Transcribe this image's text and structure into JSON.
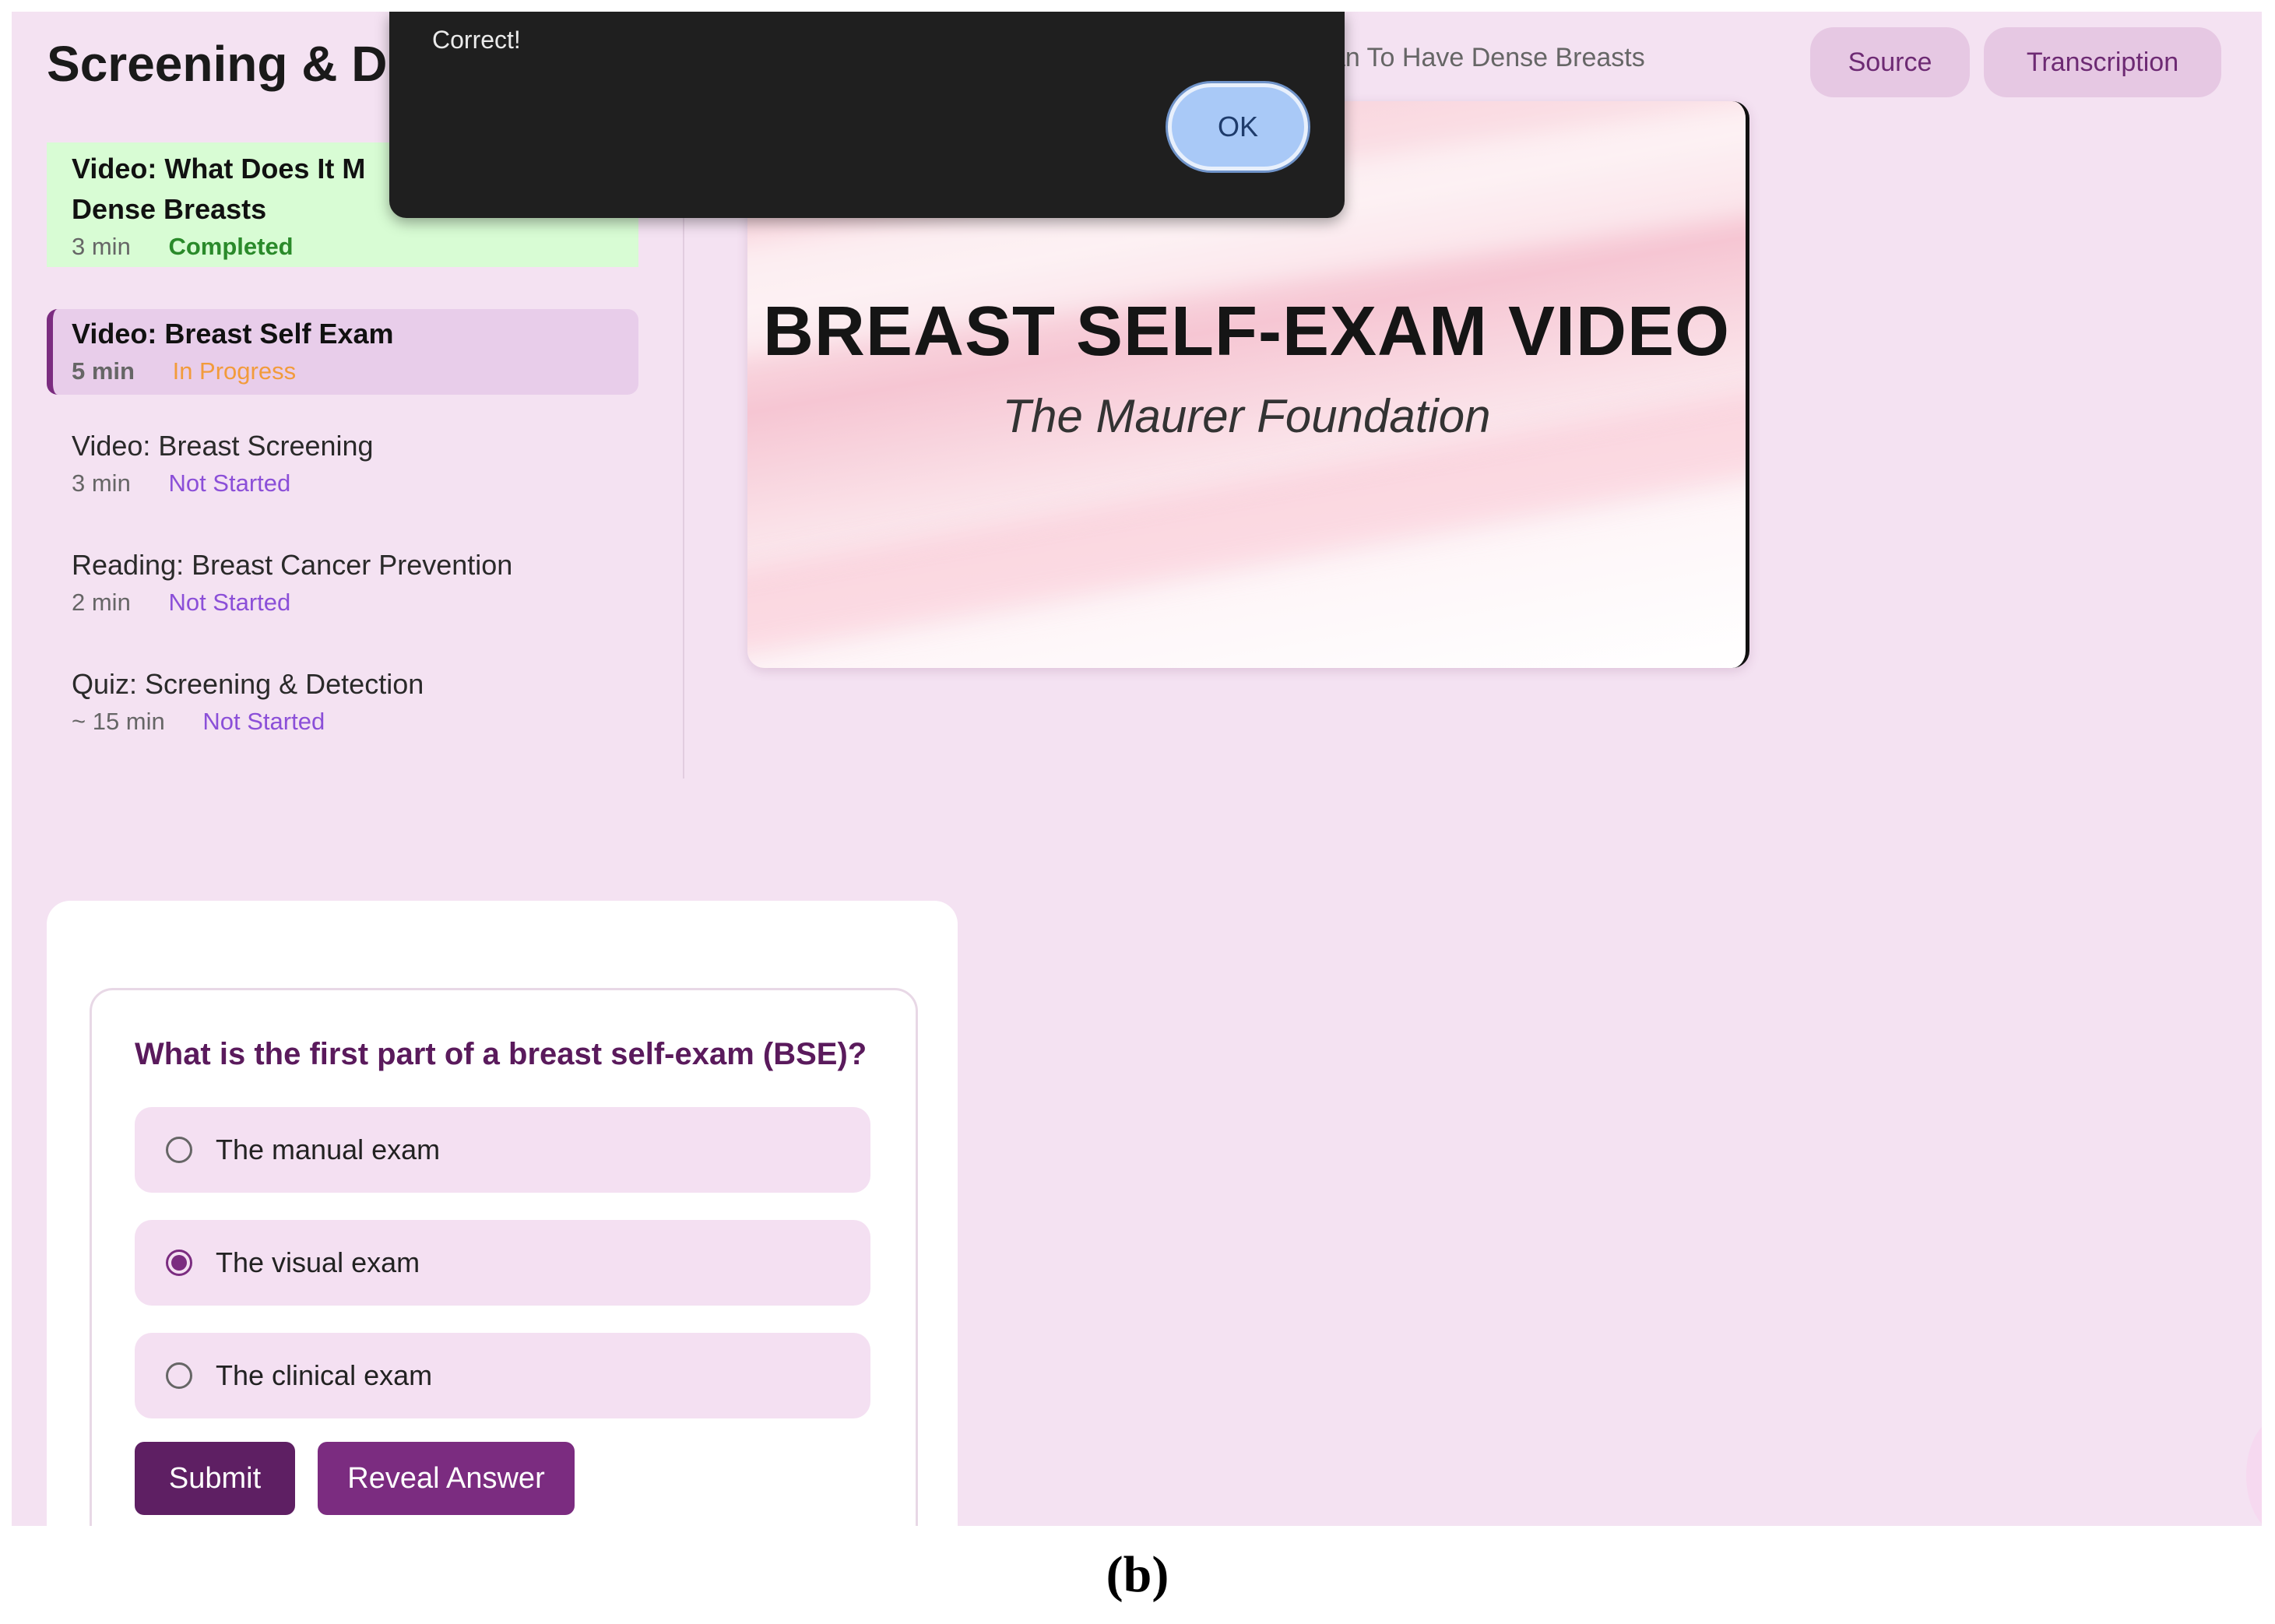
{
  "header": {
    "title": "Screening & D",
    "breadcrumb": "ean To Have Dense Breasts",
    "source_label": "Source",
    "transcription_label": "Transcription"
  },
  "sidebar": {
    "lessons": [
      {
        "title": "Video: What Does It M",
        "title_line2": "Dense Breasts",
        "duration": "3 min",
        "status": "Completed"
      },
      {
        "title": "Video: Breast Self Exam",
        "duration": "5 min",
        "status": "In Progress"
      },
      {
        "title": "Video: Breast Screening",
        "duration": "3 min",
        "status": "Not Started"
      },
      {
        "title": "Reading: Breast Cancer Prevention",
        "duration": "2 min",
        "status": "Not Started"
      },
      {
        "title": "Quiz: Screening & Detection",
        "duration": "~ 15 min",
        "status": "Not Started"
      }
    ]
  },
  "video": {
    "title": "BREAST SELF-EXAM VIDEO",
    "subtitle": "The Maurer Foundation"
  },
  "quiz": {
    "question": "What is the first part of a breast self-exam (BSE)?",
    "options": [
      {
        "label": "The manual exam",
        "selected": false
      },
      {
        "label": "The visual exam",
        "selected": true
      },
      {
        "label": "The clinical exam",
        "selected": false
      }
    ],
    "submit_label": "Submit",
    "reveal_label": "Reveal Answer"
  },
  "alert": {
    "message": "Correct!",
    "ok_label": "OK"
  },
  "caption": "(b)",
  "colors": {
    "page_bg": "#f4e2f2",
    "accent": "#7b2c80",
    "submit_bg": "#5e1f63",
    "completed_bg": "#d8fcd4",
    "completed_text": "#2a8a2a",
    "in_progress_text": "#f29b3b",
    "not_started_text": "#8b4fd8",
    "alert_bg": "#1f1f1f"
  }
}
